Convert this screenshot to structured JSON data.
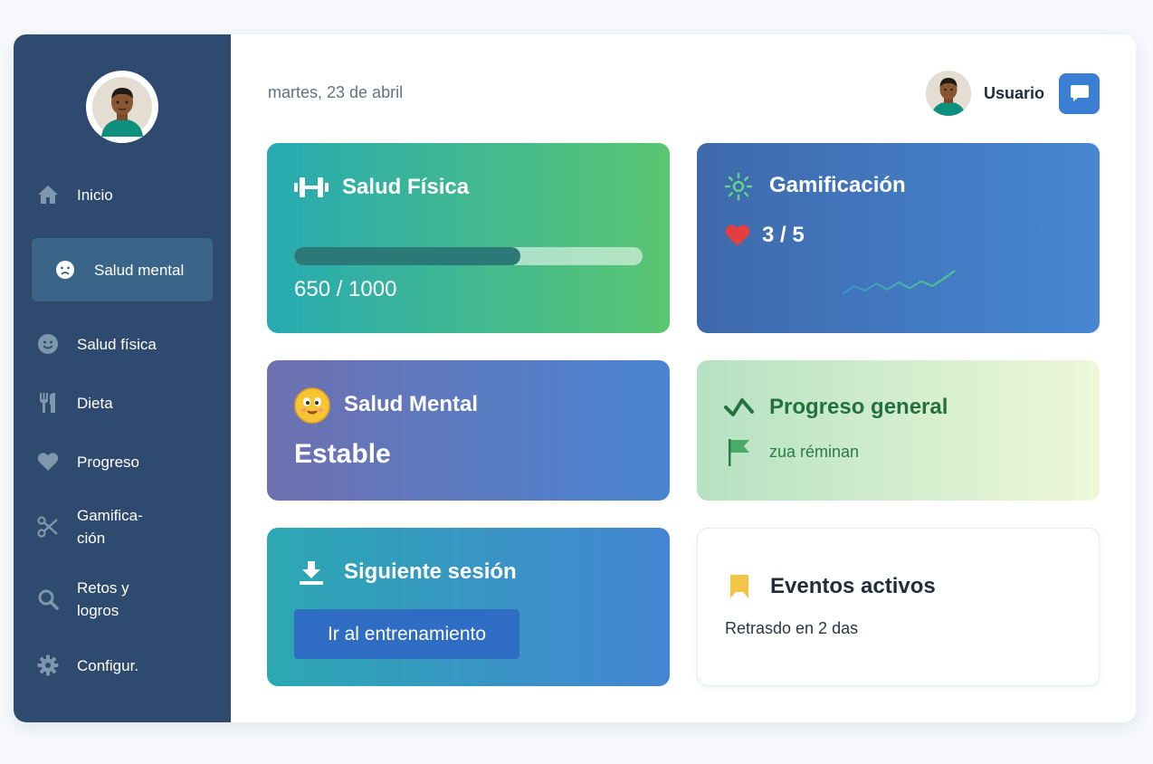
{
  "sidebar": {
    "items": [
      {
        "label": "Inicio",
        "icon": "home-icon"
      },
      {
        "label": "Salud mental",
        "icon": "sad-face-icon",
        "active": true
      },
      {
        "label": "Salud física",
        "icon": "smile-face-icon"
      },
      {
        "label": "Dieta",
        "icon": "utensils-icon"
      },
      {
        "label": "Progreso",
        "icon": "heart-icon"
      },
      {
        "label": "Gamifica-ción",
        "icon": "scissors-icon"
      },
      {
        "label": "Retos y logros",
        "icon": "search-icon"
      },
      {
        "label": "Configur.",
        "icon": "gear-icon"
      }
    ]
  },
  "header": {
    "date": "martes, 23 de abril",
    "user_name": "Usuario",
    "chat_icon": "chat-bubble-icon"
  },
  "cards": {
    "physical": {
      "title": "Salud Física",
      "icon": "dumbbell-icon",
      "progress_text": "650 / 1000",
      "progress_value": 650,
      "progress_max": 1000
    },
    "gamification": {
      "title": "Gamificación",
      "icon": "sun-icon",
      "hearts_text": "3 / 5",
      "hearts_icon": "heart-icon",
      "sparkline": [
        5,
        12,
        8,
        14,
        9,
        15,
        10,
        16,
        12,
        18,
        25
      ]
    },
    "mental": {
      "title": "Salud Mental",
      "icon": "emoji-face-icon",
      "status": "Estable"
    },
    "general": {
      "title": "Progreso general",
      "icon": "trend-check-icon",
      "subtitle": "zua réminan",
      "sub_icon": "flag-icon"
    },
    "session": {
      "title": "Siguiente sesión",
      "icon": "download-icon",
      "button_label": "Ir al entrenamiento"
    },
    "events": {
      "title": "Eventos activos",
      "icon": "bookmark-icon",
      "subtitle": "Retrasdo en 2 das"
    }
  },
  "colors": {
    "sidebar": "#2e4a6e",
    "accent": "#3b7fd4",
    "heart": "#e53e3e",
    "progress_fill": "#2b7a77"
  }
}
